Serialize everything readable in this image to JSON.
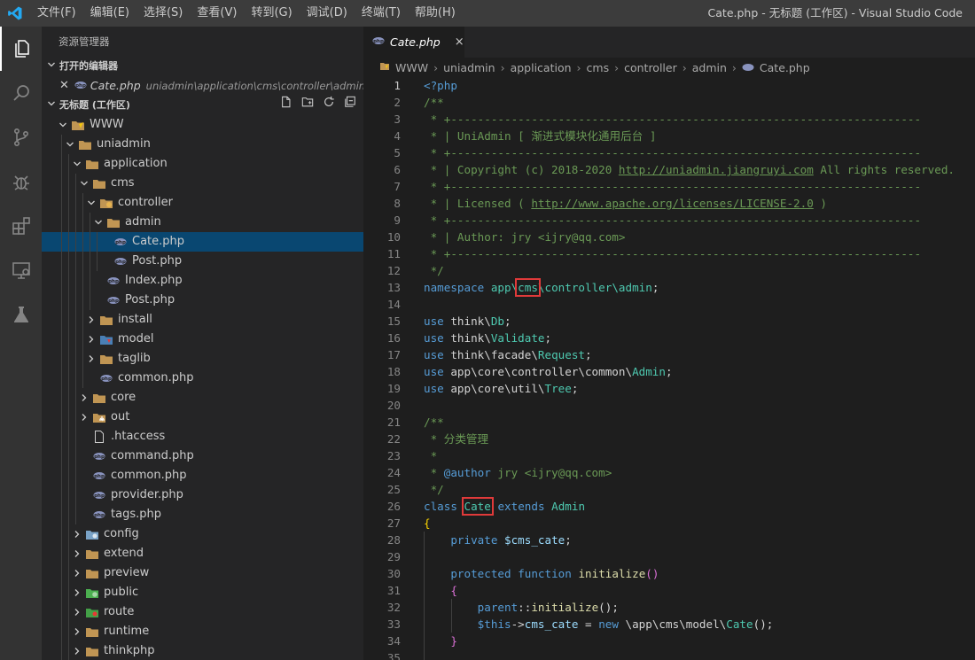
{
  "titlebar": {
    "menu": [
      "文件(F)",
      "编辑(E)",
      "选择(S)",
      "查看(V)",
      "转到(G)",
      "调试(D)",
      "终端(T)",
      "帮助(H)"
    ],
    "window_title": "Cate.php - 无标题 (工作区) - Visual Studio Code"
  },
  "activity_icons": [
    "explorer-icon",
    "search-icon",
    "source-control-icon",
    "debug-icon",
    "extensions-icon",
    "remote-explorer-icon",
    "test-flask-icon"
  ],
  "sidebar": {
    "title": "资源管理器",
    "open_editors_label": "打开的编辑器",
    "open_editor": {
      "name": "Cate.php",
      "path": "uniadmin\\application\\cms\\controller\\admin"
    },
    "workspace_label": "无标题 (工作区)",
    "tree": [
      {
        "label": "WWW",
        "depth": 0,
        "chev": "down",
        "icon": "folder-www"
      },
      {
        "label": "uniadmin",
        "depth": 1,
        "chev": "down",
        "icon": "folder"
      },
      {
        "label": "application",
        "depth": 2,
        "chev": "down",
        "icon": "folder"
      },
      {
        "label": "cms",
        "depth": 3,
        "chev": "down",
        "icon": "folder"
      },
      {
        "label": "controller",
        "depth": 4,
        "chev": "down",
        "icon": "folder-controller"
      },
      {
        "label": "admin",
        "depth": 5,
        "chev": "down",
        "icon": "folder"
      },
      {
        "label": "Cate.php",
        "depth": 6,
        "chev": "",
        "icon": "php",
        "selected": true
      },
      {
        "label": "Post.php",
        "depth": 6,
        "chev": "",
        "icon": "php"
      },
      {
        "label": "Index.php",
        "depth": 5,
        "chev": "",
        "icon": "php"
      },
      {
        "label": "Post.php",
        "depth": 5,
        "chev": "",
        "icon": "php"
      },
      {
        "label": "install",
        "depth": 4,
        "chev": "right",
        "icon": "folder"
      },
      {
        "label": "model",
        "depth": 4,
        "chev": "right",
        "icon": "folder-model"
      },
      {
        "label": "taglib",
        "depth": 4,
        "chev": "right",
        "icon": "folder"
      },
      {
        "label": "common.php",
        "depth": 4,
        "chev": "",
        "icon": "php"
      },
      {
        "label": "core",
        "depth": 3,
        "chev": "right",
        "icon": "folder"
      },
      {
        "label": "out",
        "depth": 3,
        "chev": "right",
        "icon": "folder-out"
      },
      {
        "label": ".htaccess",
        "depth": 3,
        "chev": "",
        "icon": "file"
      },
      {
        "label": "command.php",
        "depth": 3,
        "chev": "",
        "icon": "php"
      },
      {
        "label": "common.php",
        "depth": 3,
        "chev": "",
        "icon": "php"
      },
      {
        "label": "provider.php",
        "depth": 3,
        "chev": "",
        "icon": "php"
      },
      {
        "label": "tags.php",
        "depth": 3,
        "chev": "",
        "icon": "php"
      },
      {
        "label": "config",
        "depth": 2,
        "chev": "right",
        "icon": "folder-config"
      },
      {
        "label": "extend",
        "depth": 2,
        "chev": "right",
        "icon": "folder"
      },
      {
        "label": "preview",
        "depth": 2,
        "chev": "right",
        "icon": "folder"
      },
      {
        "label": "public",
        "depth": 2,
        "chev": "right",
        "icon": "folder-public"
      },
      {
        "label": "route",
        "depth": 2,
        "chev": "right",
        "icon": "folder-route"
      },
      {
        "label": "runtime",
        "depth": 2,
        "chev": "right",
        "icon": "folder"
      },
      {
        "label": "thinkphp",
        "depth": 2,
        "chev": "right",
        "icon": "folder"
      }
    ]
  },
  "editor": {
    "tab_label": "Cate.php",
    "close_glyph": "×",
    "breadcrumb": [
      "WWW",
      "uniadmin",
      "application",
      "cms",
      "controller",
      "admin",
      "Cate.php"
    ],
    "lines": [
      {
        "n": "1",
        "tokens": [
          [
            "k",
            "<?php"
          ]
        ]
      },
      {
        "n": "2",
        "tokens": [
          [
            "c",
            "/**"
          ]
        ]
      },
      {
        "n": "3",
        "tokens": [
          [
            "c",
            " * +----------------------------------------------------------------------"
          ]
        ]
      },
      {
        "n": "4",
        "tokens": [
          [
            "c",
            " * | UniAdmin [ 渐进式模块化通用后台 ]"
          ]
        ]
      },
      {
        "n": "5",
        "tokens": [
          [
            "c",
            " * +----------------------------------------------------------------------"
          ]
        ]
      },
      {
        "n": "6",
        "tokens": [
          [
            "c",
            " * | Copyright (c) 2018-2020 "
          ],
          [
            "u",
            "http://uniadmin.jiangruyi.com"
          ],
          [
            "c",
            " All rights reserved."
          ]
        ]
      },
      {
        "n": "7",
        "tokens": [
          [
            "c",
            " * +----------------------------------------------------------------------"
          ]
        ]
      },
      {
        "n": "8",
        "tokens": [
          [
            "c",
            " * | Licensed ( "
          ],
          [
            "u",
            "http://www.apache.org/licenses/LICENSE-2.0"
          ],
          [
            "c",
            " )"
          ]
        ]
      },
      {
        "n": "9",
        "tokens": [
          [
            "c",
            " * +----------------------------------------------------------------------"
          ]
        ]
      },
      {
        "n": "10",
        "tokens": [
          [
            "c",
            " * | Author: jry <ijry@qq.com>"
          ]
        ]
      },
      {
        "n": "11",
        "tokens": [
          [
            "c",
            " * +----------------------------------------------------------------------"
          ]
        ]
      },
      {
        "n": "12",
        "tokens": [
          [
            "c",
            " */"
          ]
        ]
      },
      {
        "n": "13",
        "tokens": [
          [
            "k",
            "namespace"
          ],
          [
            "t",
            " app\\"
          ],
          [
            "t",
            "cms",
            "hl"
          ],
          [
            "t",
            "\\controller\\admin"
          ],
          [
            "p",
            ";"
          ]
        ]
      },
      {
        "n": "14",
        "tokens": []
      },
      {
        "n": "15",
        "tokens": [
          [
            "k",
            "use"
          ],
          [
            "p",
            " think\\"
          ],
          [
            "t",
            "Db"
          ],
          [
            "p",
            ";"
          ]
        ]
      },
      {
        "n": "16",
        "tokens": [
          [
            "k",
            "use"
          ],
          [
            "p",
            " think\\"
          ],
          [
            "t",
            "Validate"
          ],
          [
            "p",
            ";"
          ]
        ]
      },
      {
        "n": "17",
        "tokens": [
          [
            "k",
            "use"
          ],
          [
            "p",
            " think\\facade\\"
          ],
          [
            "t",
            "Request"
          ],
          [
            "p",
            ";"
          ]
        ]
      },
      {
        "n": "18",
        "tokens": [
          [
            "k",
            "use"
          ],
          [
            "p",
            " app\\core\\controller\\common\\"
          ],
          [
            "t",
            "Admin"
          ],
          [
            "p",
            ";"
          ]
        ]
      },
      {
        "n": "19",
        "tokens": [
          [
            "k",
            "use"
          ],
          [
            "p",
            " app\\core\\util\\"
          ],
          [
            "t",
            "Tree"
          ],
          [
            "p",
            ";"
          ]
        ]
      },
      {
        "n": "20",
        "tokens": []
      },
      {
        "n": "21",
        "tokens": [
          [
            "c",
            "/**"
          ]
        ]
      },
      {
        "n": "22",
        "tokens": [
          [
            "c",
            " * 分类管理"
          ]
        ]
      },
      {
        "n": "23",
        "tokens": [
          [
            "c",
            " *"
          ]
        ]
      },
      {
        "n": "24",
        "tokens": [
          [
            "c",
            " * "
          ],
          [
            "k",
            "@author"
          ],
          [
            "c",
            " jry <ijry@qq.com>"
          ]
        ]
      },
      {
        "n": "25",
        "tokens": [
          [
            "c",
            " */"
          ]
        ]
      },
      {
        "n": "26",
        "tokens": [
          [
            "k",
            "class"
          ],
          [
            "p",
            " "
          ],
          [
            "t",
            "Cate",
            "hl"
          ],
          [
            "p",
            " "
          ],
          [
            "k",
            "extends"
          ],
          [
            "p",
            " "
          ],
          [
            "t",
            "Admin"
          ]
        ]
      },
      {
        "n": "27",
        "tokens": [
          [
            "y",
            "{"
          ]
        ]
      },
      {
        "n": "28",
        "tokens": [
          [
            "p",
            "    "
          ],
          [
            "k",
            "private"
          ],
          [
            "p",
            " "
          ],
          [
            "v",
            "$cms_cate"
          ],
          [
            "p",
            ";"
          ]
        ]
      },
      {
        "n": "29",
        "tokens": []
      },
      {
        "n": "30",
        "tokens": [
          [
            "p",
            "    "
          ],
          [
            "k",
            "protected"
          ],
          [
            "p",
            " "
          ],
          [
            "k",
            "function"
          ],
          [
            "p",
            " "
          ],
          [
            "f",
            "initialize"
          ],
          [
            "m",
            "()"
          ]
        ]
      },
      {
        "n": "31",
        "tokens": [
          [
            "p",
            "    "
          ],
          [
            "m",
            "{"
          ]
        ]
      },
      {
        "n": "32",
        "tokens": [
          [
            "p",
            "        "
          ],
          [
            "k",
            "parent"
          ],
          [
            "p",
            "::"
          ],
          [
            "f",
            "initialize"
          ],
          [
            "p",
            "();"
          ]
        ]
      },
      {
        "n": "33",
        "tokens": [
          [
            "p",
            "        "
          ],
          [
            "k",
            "$this"
          ],
          [
            "p",
            "->"
          ],
          [
            "v",
            "cms_cate"
          ],
          [
            "p",
            " = "
          ],
          [
            "k",
            "new"
          ],
          [
            "p",
            " \\app\\cms\\model\\"
          ],
          [
            "t",
            "Cate"
          ],
          [
            "p",
            "();"
          ]
        ]
      },
      {
        "n": "34",
        "tokens": [
          [
            "p",
            "    "
          ],
          [
            "m",
            "}"
          ]
        ]
      },
      {
        "n": "35",
        "tokens": []
      }
    ]
  }
}
